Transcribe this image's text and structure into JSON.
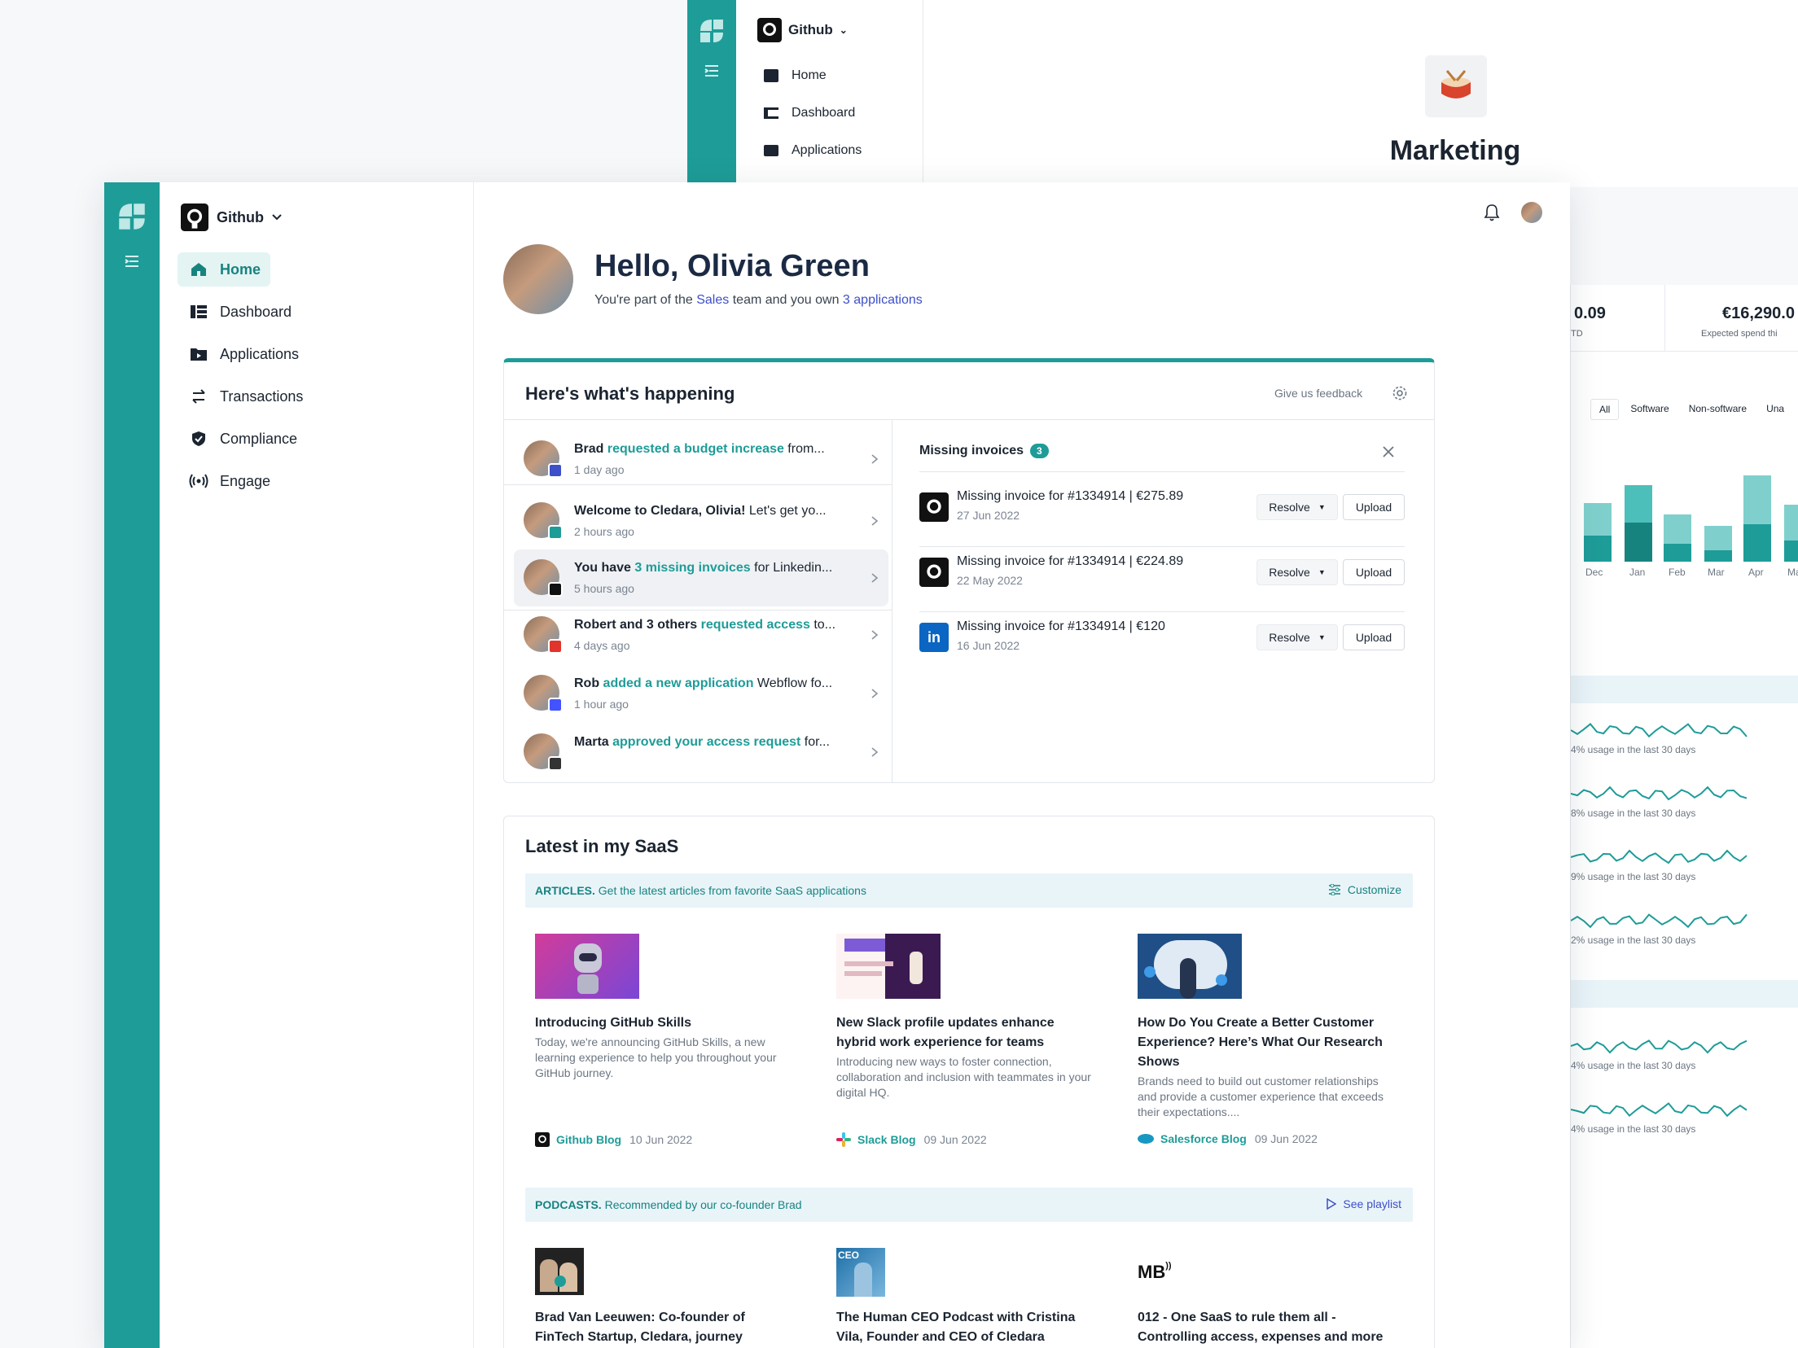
{
  "background": {
    "org": "Github",
    "nav": [
      "Home",
      "Dashboard",
      "Applications"
    ],
    "team_title": "Marketing",
    "stats": [
      {
        "value": "0.09",
        "label": "TD"
      },
      {
        "value": "€16,290.0",
        "label": "Expected spend thi"
      }
    ],
    "filters": [
      "All",
      "Software",
      "Non-software",
      "Una"
    ],
    "months": [
      "Dec",
      "Jan",
      "Feb",
      "Mar",
      "Apr",
      "Ma"
    ],
    "usage": [
      "4% usage in the last 30 days",
      "8% usage in the last 30 days",
      "9% usage in the last 30 days",
      "2% usage in the last 30 days",
      "4% usage in the last 30 days",
      "4% usage in the last 30 days"
    ]
  },
  "sidebar": {
    "org": "Github",
    "items": [
      {
        "label": "Home",
        "icon": "home-icon"
      },
      {
        "label": "Dashboard",
        "icon": "dashboard-icon"
      },
      {
        "label": "Applications",
        "icon": "folder-icon"
      },
      {
        "label": "Transactions",
        "icon": "transfer-icon"
      },
      {
        "label": "Compliance",
        "icon": "shield-icon"
      },
      {
        "label": "Engage",
        "icon": "broadcast-icon"
      }
    ]
  },
  "header": {
    "greeting": "Hello, Olivia Green",
    "sub_pre": "You're part of the",
    "team": "Sales",
    "sub_mid": "team and you own",
    "apps": "3 applications"
  },
  "happening": {
    "title": "Here's what's happening",
    "feedback": "Give us feedback",
    "activities": [
      {
        "name": "Brad",
        "action": "requested a budget increase",
        "rest": " from...",
        "time": "1 day ago"
      },
      {
        "name": "Welcome to Cledara, Olivia!",
        "action": "",
        "rest": " Let's get yo...",
        "time": "2 hours ago"
      },
      {
        "name": "You have",
        "action": "3 missing invoices",
        "rest": " for Linkedin...",
        "time": "5 hours ago"
      },
      {
        "name": "Robert and 3 others",
        "action": "requested access",
        "rest": " to...",
        "time": "4 days ago"
      },
      {
        "name": "Rob",
        "action": "added a new application",
        "rest": " Webflow fo...",
        "time": "1 hour ago"
      },
      {
        "name": "Marta",
        "action": "approved your access request",
        "rest": " for...",
        "time": ""
      }
    ],
    "missing": {
      "title": "Missing invoices",
      "count": "3",
      "resolve_label": "Resolve",
      "upload_label": "Upload",
      "items": [
        {
          "text": "Missing invoice for #1334914 | €275.89",
          "date": "27 Jun 2022",
          "icon": "github-icon"
        },
        {
          "text": "Missing invoice for #1334914 | €224.89",
          "date": "22 May 2022",
          "icon": "github-icon"
        },
        {
          "text": "Missing invoice for #1334914 | €120",
          "date": "16 Jun 2022",
          "icon": "linkedin-icon"
        }
      ]
    }
  },
  "saas": {
    "title": "Latest in my SaaS",
    "articles_tag": "ARTICLES.",
    "articles_text": " Get the latest articles from favorite SaaS applications",
    "customize": "Customize",
    "articles": [
      {
        "title": "Introducing GitHub Skills",
        "desc": "Today, we're announcing GitHub Skills, a new learning experience to help you throughout your GitHub journey.",
        "source": "Github Blog",
        "date": "10 Jun 2022"
      },
      {
        "title": "New Slack profile updates enhance hybrid work experience for teams",
        "desc": "Introducing new ways to foster connection, collaboration and inclusion with teammates in your digital HQ.",
        "source": "Slack Blog",
        "date": "09 Jun 2022"
      },
      {
        "title": "How Do You Create a Better Customer Experience? Here’s What Our Research Shows",
        "desc": "Brands need to build out customer relationships and provide a customer experience that exceeds their expectations....",
        "source": "Salesforce Blog",
        "date": "09 Jun 2022"
      }
    ],
    "podcasts_tag": "PODCASTS.",
    "podcasts_text": " Recommended by our co-founder Brad",
    "playlist": "See playlist",
    "podcasts": [
      {
        "title": "Brad Van Leeuwen: Co-founder of FinTech Startup, Cledara, journey"
      },
      {
        "title": "The Human CEO Podcast with Cristina Vila, Founder and CEO of Cledara",
        "badge": "CEO"
      },
      {
        "title": "012 - One SaaS to rule them all - Controlling access, expenses and more",
        "badge": "MB"
      }
    ]
  },
  "colors": {
    "accent": "#1e9c98",
    "link": "#3d4fc9",
    "rail": "#1e9c98"
  }
}
